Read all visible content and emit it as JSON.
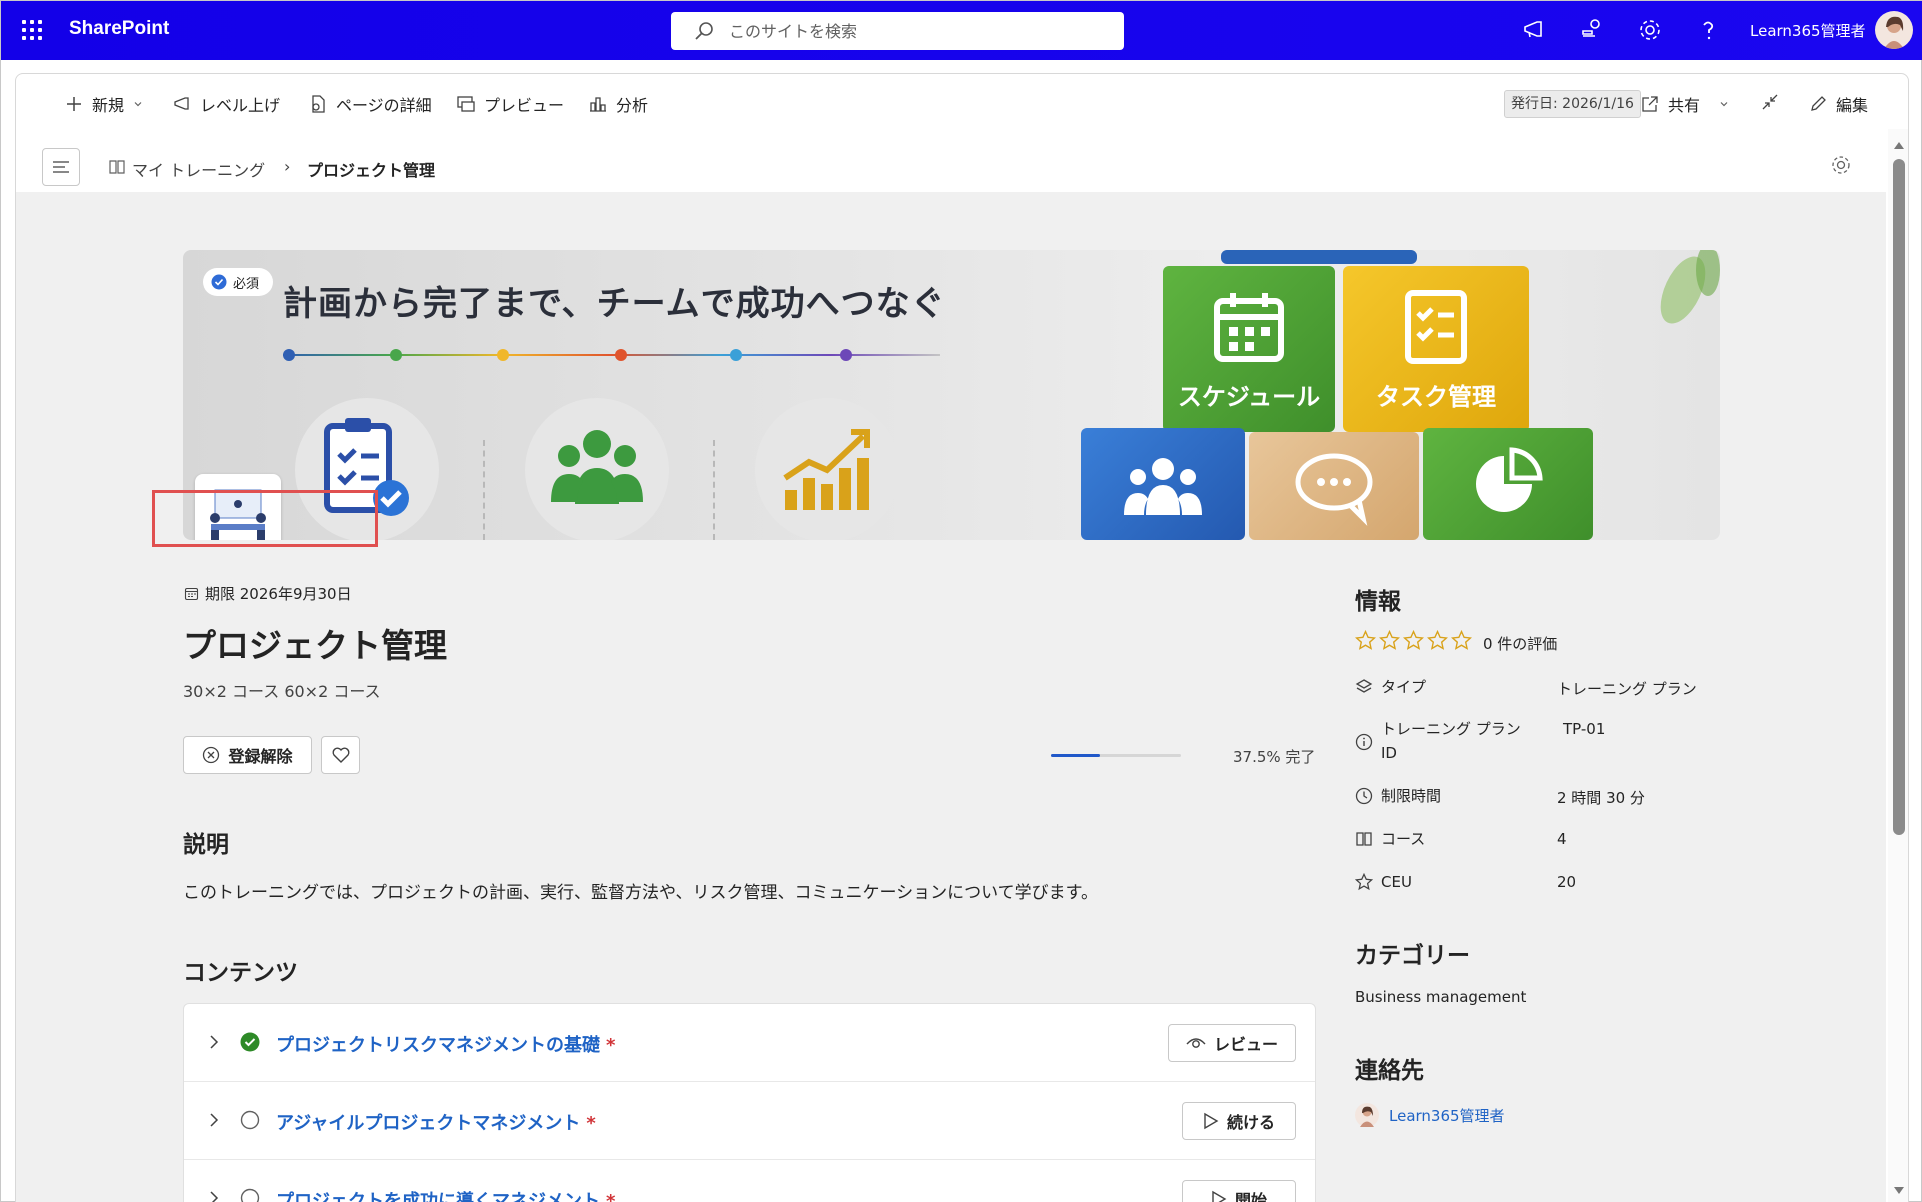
{
  "suitebar": {
    "brand": "SharePoint",
    "search_placeholder": "このサイトを検索",
    "user_name": "Learn365管理者"
  },
  "cmdbar": {
    "new": "新規",
    "promote": "レベル上げ",
    "page_details": "ページの詳細",
    "preview": "プレビュー",
    "analytics": "分析",
    "published": "発行日: 2026/1/16",
    "share": "共有",
    "edit": "編集"
  },
  "breadcrumb": {
    "parent": "マイ トレーニング",
    "separator": "›",
    "current": "プロジェクト管理"
  },
  "banner": {
    "required_badge": "必須",
    "title": "計画から完了まで、チームで成功へつなぐ",
    "block_schedule": "スケジュール",
    "block_task": "タスク管理"
  },
  "plan": {
    "due": "期限 2026年9月30日",
    "title": "プロジェクト管理",
    "subtitle": "30×2 コース 60×2 コース",
    "unenroll": "登録解除",
    "progress_percent": 37.5,
    "progress_text": "37.5% 完了"
  },
  "description": {
    "heading": "説明",
    "text": "このトレーニングでは、プロジェクトの計画、実行、監督方法や、リスク管理、コミュニケーションについて学びます。"
  },
  "contents": {
    "heading": "コンテンツ",
    "items": [
      {
        "title": "プロジェクトリスクマネジメントの基礎",
        "required": "*",
        "status": "completed",
        "action": "レビュー"
      },
      {
        "title": "アジャイルプロジェクトマネジメント",
        "required": "*",
        "status": "not-completed",
        "action": "続ける"
      },
      {
        "title": "プロジェクトを成功に導くマネジメント",
        "required": "*",
        "status": "not-started",
        "action": "開始"
      }
    ]
  },
  "info": {
    "heading": "情報",
    "rating_text": "0 件の評価",
    "rating_stars": 0,
    "rows": [
      {
        "label": "タイプ",
        "value": "トレーニング プラン"
      },
      {
        "label": "トレーニング プラン ID",
        "value": "TP-01"
      },
      {
        "label": "制限時間",
        "value": "2 時間 30 分"
      },
      {
        "label": "コース",
        "value": "4"
      },
      {
        "label": "CEU",
        "value": "20"
      }
    ]
  },
  "category": {
    "heading": "カテゴリー",
    "value": "Business management"
  },
  "contact": {
    "heading": "連絡先",
    "name": "Learn365管理者"
  },
  "colors": {
    "suitebar": "#1300e8",
    "link": "#1f63c5",
    "progress": "#2058c9",
    "completed": "#2e8a28",
    "highlight_box": "#e05050"
  }
}
